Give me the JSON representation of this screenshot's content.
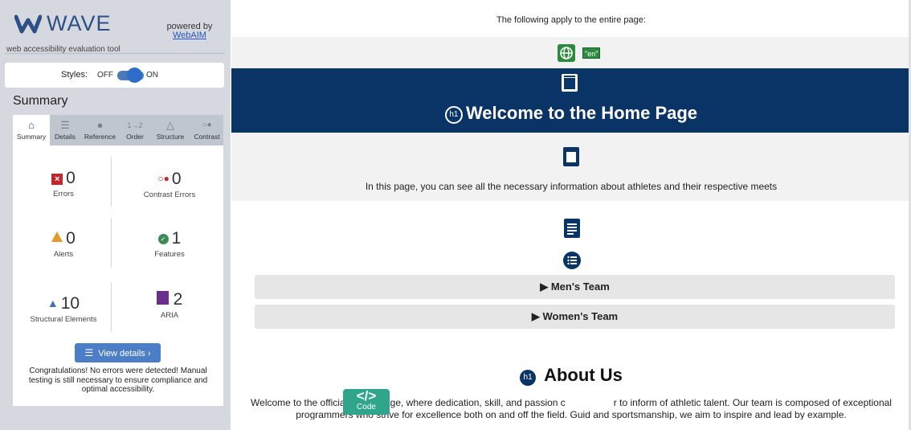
{
  "sidebar": {
    "logo_text": "WAVE",
    "powered_by": "powered by",
    "powered_link": "WebAIM",
    "tagline": "web accessibility evaluation tool",
    "styles_label": "Styles:",
    "styles_off": "OFF",
    "styles_on": "ON",
    "summary_title": "Summary",
    "tabs": [
      {
        "label": "Summary",
        "icon": "home-icon"
      },
      {
        "label": "Details",
        "icon": "list-icon"
      },
      {
        "label": "Reference",
        "icon": "info-icon"
      },
      {
        "label": "Order",
        "icon": "order-icon"
      },
      {
        "label": "Structure",
        "icon": "structure-icon"
      },
      {
        "label": "Contrast",
        "icon": "contrast-icon"
      }
    ],
    "stats": {
      "errors": {
        "value": "0",
        "label": "Errors"
      },
      "contrast_errors": {
        "value": "0",
        "label": "Contrast Errors"
      },
      "alerts": {
        "value": "0",
        "label": "Alerts"
      },
      "features": {
        "value": "1",
        "label": "Features"
      },
      "structural": {
        "value": "10",
        "label": "Structural Elements"
      },
      "aria": {
        "value": "2",
        "label": "ARIA"
      }
    },
    "view_details": "View details ›",
    "congrats": "Congratulations! No errors were detected! Manual testing is still necessary to ensure compliance and optimal accessibility."
  },
  "page": {
    "applies_text": "The following apply to the entire page:",
    "lang_tag": "\"en\"",
    "hero_title": "Welcome to the Home Page",
    "h1_badge": "h1",
    "intro_text": "In this page, you can see all the necessary information about athletes and their respective meets",
    "accordions": [
      "▶ Men's Team",
      "▶ Women's Team"
    ],
    "about_title": "About Us",
    "welcome_text_left": "Welcome to the official Home Page, where dedication, skill, and passion c",
    "welcome_text_right": "r to inform of athletic talent. Our team is composed of exceptional",
    "welcome_line2": "programmers who strive for excellence both on and off the field. Guid                       and sportsmanship, we aim to inspire and lead by example."
  },
  "code_button": {
    "symbol": "</>",
    "label": "Code"
  },
  "colors": {
    "sidebar_bg": "#d5d9df",
    "hero_bg": "#0b3466",
    "accent_blue": "#4c7ec7",
    "error_red": "#c0282e",
    "alert_orange": "#e29b26",
    "feature_green": "#3c8a58",
    "aria_purple": "#6a2f8a",
    "code_teal": "#2fa58c"
  }
}
